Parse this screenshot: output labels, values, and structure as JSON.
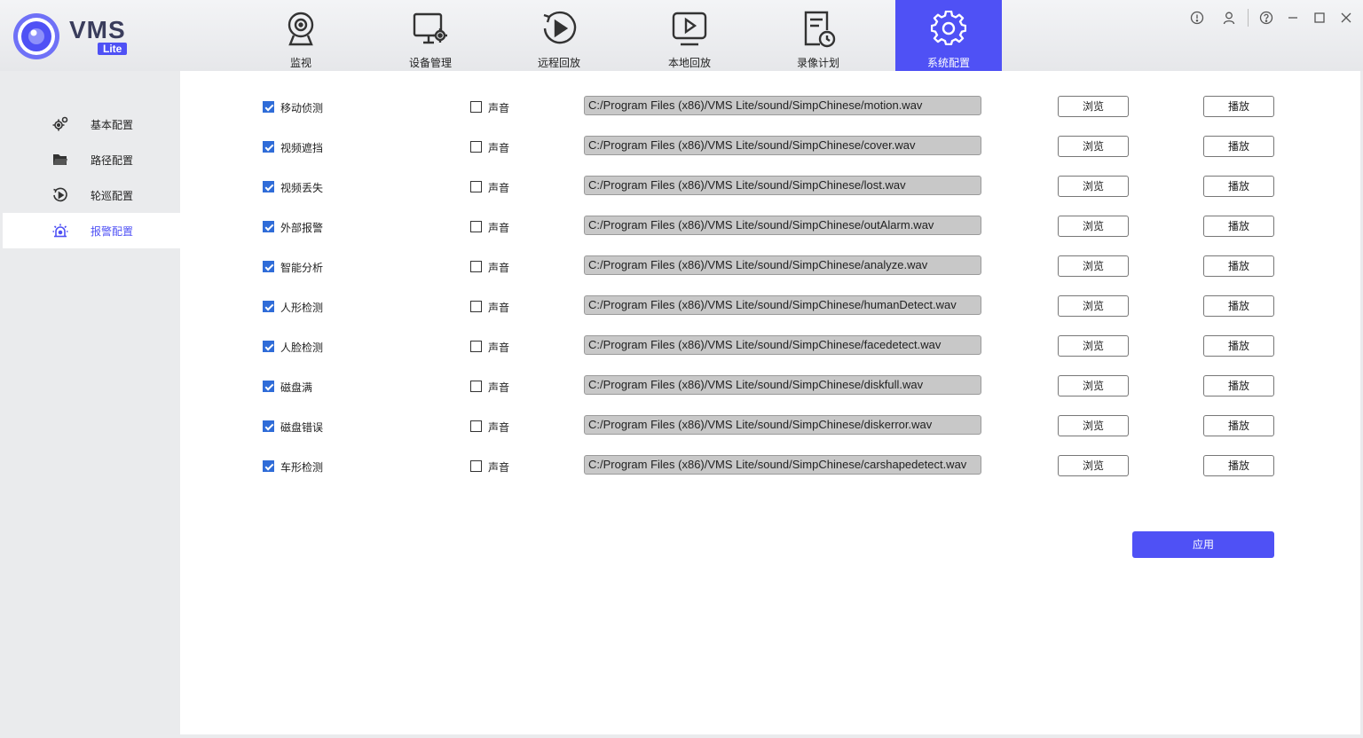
{
  "app": {
    "logo_text": "VMS",
    "logo_badge": "Lite"
  },
  "colors": {
    "accent": "#4f51f5",
    "checkbox": "#2f6cd8",
    "path_bg": "#c8c8c8"
  },
  "nav": [
    {
      "label": "监视",
      "icon": "webcam-icon"
    },
    {
      "label": "设备管理",
      "icon": "monitor-gear-icon"
    },
    {
      "label": "远程回放",
      "icon": "circle-play-icon"
    },
    {
      "label": "本地回放",
      "icon": "screen-play-icon"
    },
    {
      "label": "录像计划",
      "icon": "document-clock-icon"
    },
    {
      "label": "系统配置",
      "icon": "gear-icon",
      "active": true
    }
  ],
  "window_controls": [
    "info-icon",
    "user-icon",
    "help-icon",
    "minimize-icon",
    "maximize-icon",
    "close-icon"
  ],
  "sidebar": [
    {
      "label": "基本配置",
      "icon": "gears-icon"
    },
    {
      "label": "路径配置",
      "icon": "folder-icon"
    },
    {
      "label": "轮巡配置",
      "icon": "cycle-play-icon"
    },
    {
      "label": "报警配置",
      "icon": "alarm-light-icon",
      "active": true
    }
  ],
  "alarm_rows": [
    {
      "name": "移动侦测",
      "enabled": true,
      "sound_label": "声音",
      "sound": false,
      "path": "C:/Program Files (x86)/VMS Lite/sound/SimpChinese/motion.wav",
      "browse": "浏览",
      "play": "播放"
    },
    {
      "name": "视频遮挡",
      "enabled": true,
      "sound_label": "声音",
      "sound": false,
      "path": "C:/Program Files (x86)/VMS Lite/sound/SimpChinese/cover.wav",
      "browse": "浏览",
      "play": "播放"
    },
    {
      "name": "视频丢失",
      "enabled": true,
      "sound_label": "声音",
      "sound": false,
      "path": "C:/Program Files (x86)/VMS Lite/sound/SimpChinese/lost.wav",
      "browse": "浏览",
      "play": "播放"
    },
    {
      "name": "外部报警",
      "enabled": true,
      "sound_label": "声音",
      "sound": false,
      "path": "C:/Program Files (x86)/VMS Lite/sound/SimpChinese/outAlarm.wav",
      "browse": "浏览",
      "play": "播放"
    },
    {
      "name": "智能分析",
      "enabled": true,
      "sound_label": "声音",
      "sound": false,
      "path": "C:/Program Files (x86)/VMS Lite/sound/SimpChinese/analyze.wav",
      "browse": "浏览",
      "play": "播放"
    },
    {
      "name": "人形检测",
      "enabled": true,
      "sound_label": "声音",
      "sound": false,
      "path": "C:/Program Files (x86)/VMS Lite/sound/SimpChinese/humanDetect.wav",
      "browse": "浏览",
      "play": "播放"
    },
    {
      "name": "人脸检测",
      "enabled": true,
      "sound_label": "声音",
      "sound": false,
      "path": "C:/Program Files (x86)/VMS Lite/sound/SimpChinese/facedetect.wav",
      "browse": "浏览",
      "play": "播放"
    },
    {
      "name": "磁盘满",
      "enabled": true,
      "sound_label": "声音",
      "sound": false,
      "path": "C:/Program Files (x86)/VMS Lite/sound/SimpChinese/diskfull.wav",
      "browse": "浏览",
      "play": "播放"
    },
    {
      "name": "磁盘错误",
      "enabled": true,
      "sound_label": "声音",
      "sound": false,
      "path": "C:/Program Files (x86)/VMS Lite/sound/SimpChinese/diskerror.wav",
      "browse": "浏览",
      "play": "播放"
    },
    {
      "name": "车形检测",
      "enabled": true,
      "sound_label": "声音",
      "sound": false,
      "path": "C:/Program Files (x86)/VMS Lite/sound/SimpChinese/carshapedetect.wav",
      "browse": "浏览",
      "play": "播放"
    }
  ],
  "apply_label": "应用"
}
